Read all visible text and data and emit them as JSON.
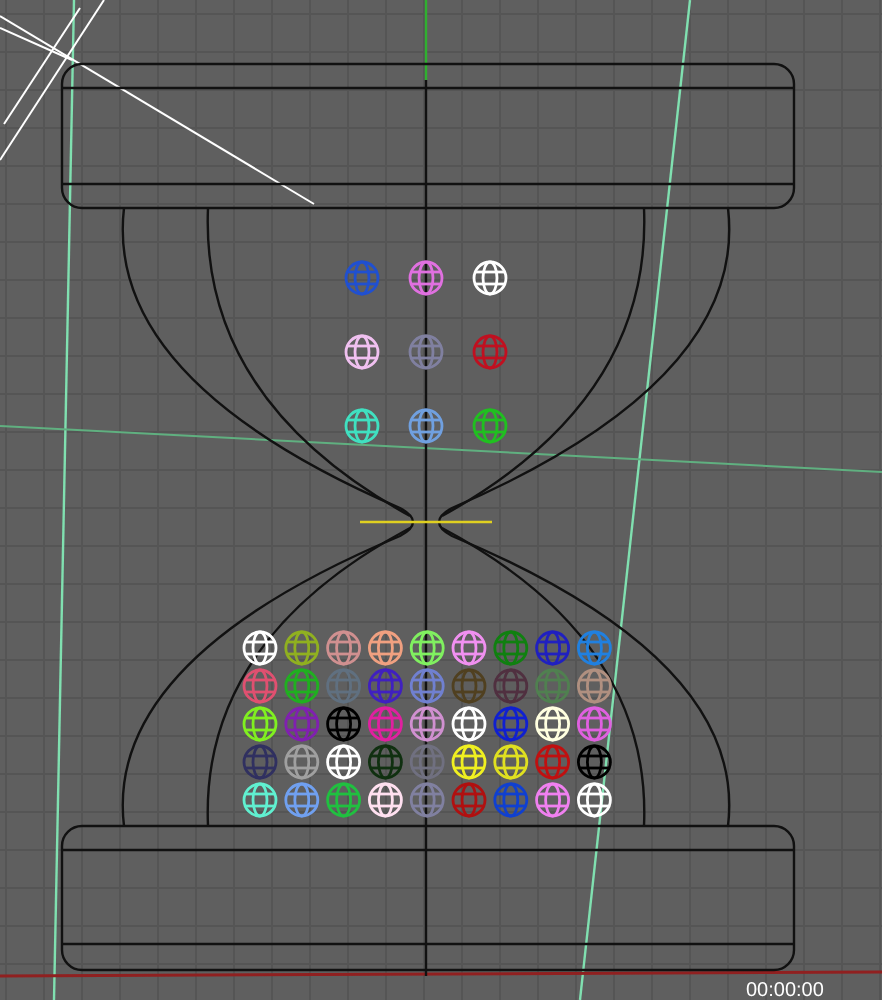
{
  "viewport": {
    "spheres_top": [
      {
        "color": "#2050d0"
      },
      {
        "color": "#e070e0"
      },
      {
        "color": "#ffffff"
      },
      {
        "color": "#f0c0f0"
      },
      {
        "color": "#8080a0"
      },
      {
        "color": "#c01020"
      },
      {
        "color": "#40e0c0"
      },
      {
        "color": "#70a0e0"
      },
      {
        "color": "#20c020"
      }
    ],
    "spheres_bottom": [
      {
        "color": "#ffffff"
      },
      {
        "color": "#90b020"
      },
      {
        "color": "#d09090"
      },
      {
        "color": "#f0a080"
      },
      {
        "color": "#80f060"
      },
      {
        "color": "#f090f0"
      },
      {
        "color": "#108010"
      },
      {
        "color": "#2020c0"
      },
      {
        "color": "#2080e0"
      },
      {
        "color": "#e05070"
      },
      {
        "color": "#20b020"
      },
      {
        "color": "#607080"
      },
      {
        "color": "#4020c0"
      },
      {
        "color": "#7080d0"
      },
      {
        "color": "#504020"
      },
      {
        "color": "#503040"
      },
      {
        "color": "#508050"
      },
      {
        "color": "#b09080"
      },
      {
        "color": "#80f020"
      },
      {
        "color": "#8020b0"
      },
      {
        "color": "#000000"
      },
      {
        "color": "#e020a0"
      },
      {
        "color": "#d090d0"
      },
      {
        "color": "#ffffff"
      },
      {
        "color": "#1020d0"
      },
      {
        "color": "#ffffe0"
      },
      {
        "color": "#e060e0"
      },
      {
        "color": "#303060"
      },
      {
        "color": "#a0a0a0"
      },
      {
        "color": "#ffffff"
      },
      {
        "color": "#103010"
      },
      {
        "color": "#707080"
      },
      {
        "color": "#f0f020"
      },
      {
        "color": "#e0e020"
      },
      {
        "color": "#c01010"
      },
      {
        "color": "#000000"
      },
      {
        "color": "#60f0d0"
      },
      {
        "color": "#70a0f0"
      },
      {
        "color": "#20c040"
      },
      {
        "color": "#ffe0f0"
      },
      {
        "color": "#8080a0"
      },
      {
        "color": "#b01010"
      },
      {
        "color": "#1040d0"
      },
      {
        "color": "#f080f0"
      },
      {
        "color": "#ffffff"
      }
    ]
  },
  "timecode": "00:00:00"
}
